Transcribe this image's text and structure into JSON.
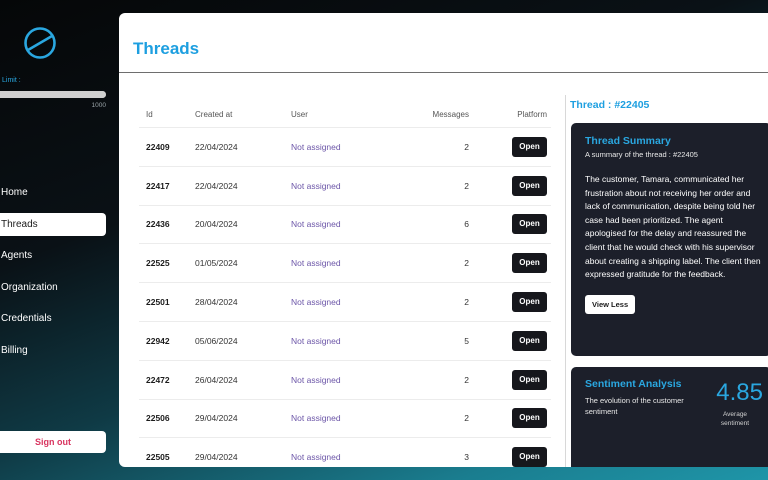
{
  "sidebar": {
    "logo_icon": "globe-slash-logo",
    "limit": {
      "label": "Limit :",
      "max": "1000",
      "fill_fraction": 1.0
    },
    "nav": [
      {
        "label": "Home",
        "active": false
      },
      {
        "label": "Threads",
        "active": true
      },
      {
        "label": "Agents",
        "active": false
      },
      {
        "label": "Organization",
        "active": false
      },
      {
        "label": "Credentials",
        "active": false
      },
      {
        "label": "Billing",
        "active": false
      }
    ],
    "signout": "Sign out"
  },
  "header": {
    "title": "Threads"
  },
  "table": {
    "columns": {
      "id": "Id",
      "created": "Created at",
      "user": "User",
      "messages": "Messages",
      "platform": "Platform"
    },
    "open_label": "Open",
    "rows": [
      {
        "id": "22409",
        "created": "22/04/2024",
        "user": "Not assigned",
        "messages": "2"
      },
      {
        "id": "22417",
        "created": "22/04/2024",
        "user": "Not assigned",
        "messages": "2"
      },
      {
        "id": "22436",
        "created": "20/04/2024",
        "user": "Not assigned",
        "messages": "6"
      },
      {
        "id": "22525",
        "created": "01/05/2024",
        "user": "Not assigned",
        "messages": "2"
      },
      {
        "id": "22501",
        "created": "28/04/2024",
        "user": "Not assigned",
        "messages": "2"
      },
      {
        "id": "22942",
        "created": "05/06/2024",
        "user": "Not assigned",
        "messages": "5"
      },
      {
        "id": "22472",
        "created": "26/04/2024",
        "user": "Not assigned",
        "messages": "2"
      },
      {
        "id": "22506",
        "created": "29/04/2024",
        "user": "Not assigned",
        "messages": "2"
      },
      {
        "id": "22505",
        "created": "29/04/2024",
        "user": "Not assigned",
        "messages": "3"
      }
    ]
  },
  "detail": {
    "title": "Thread : #22405",
    "summary": {
      "title": "Thread Summary",
      "subtitle": "A summary of the thread : #22405",
      "text": "The customer, Tamara, communicated her frustration about not receiving her order and lack of communication, despite being told her case had been prioritized. The agent apologised for the delay and reassured the client that he would check with his supervisor about creating a shipping label. The client then expressed gratitude for the feedback.",
      "button": "View Less"
    },
    "sentiment": {
      "title": "Sentiment Analysis",
      "description": "The evolution of the customer sentiment",
      "value": "4.85",
      "value_label": "Average sentiment"
    }
  },
  "colors": {
    "accent": "#1d9fe0",
    "user_text": "#6c56a8",
    "signout": "#d8345f",
    "card_bg": "#1c1f2a"
  }
}
